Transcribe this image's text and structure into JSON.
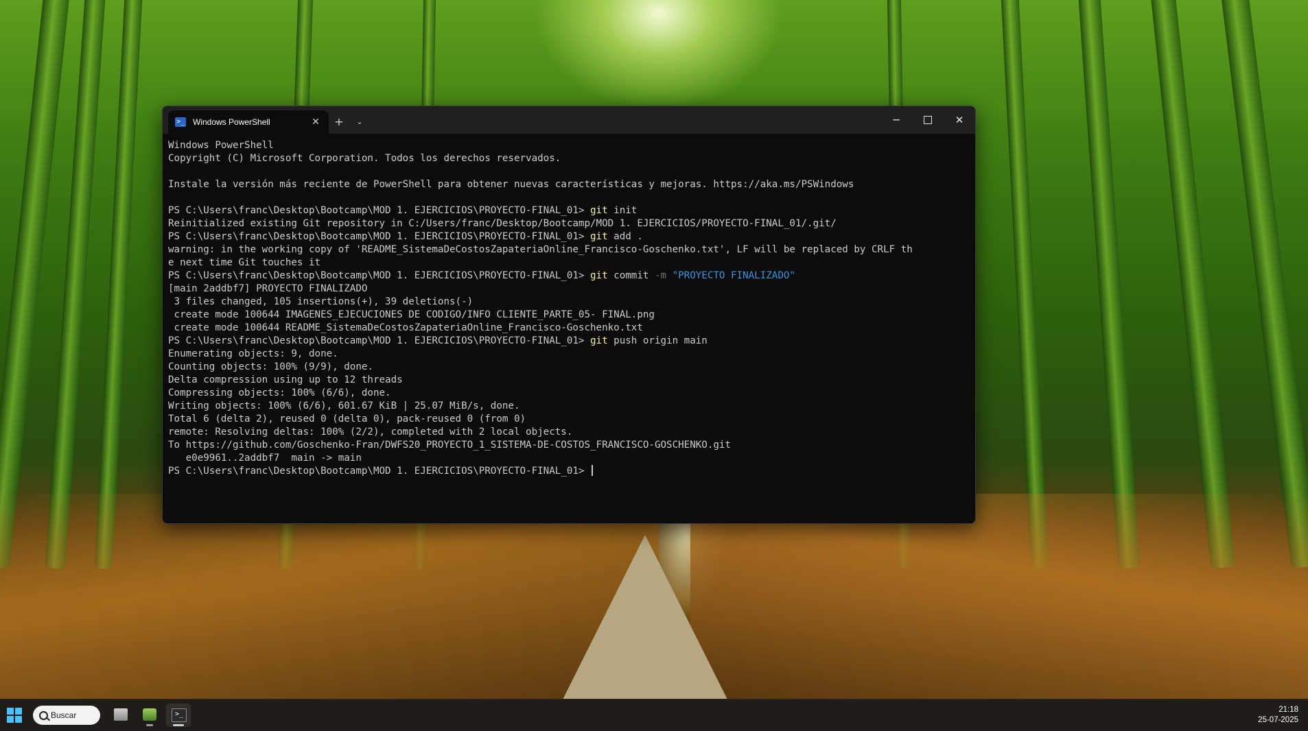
{
  "window": {
    "tab_title": "Windows PowerShell",
    "tab_icon": "powershell-icon",
    "new_tab_label": "+",
    "dropdown_icon": "chevron-down-icon",
    "minimize_icon": "minimize-icon",
    "maximize_icon": "maximize-icon",
    "close_icon": "close-icon"
  },
  "console": {
    "lines": [
      {
        "type": "text",
        "text": "Windows PowerShell"
      },
      {
        "type": "text",
        "text": "Copyright (C) Microsoft Corporation. Todos los derechos reservados."
      },
      {
        "type": "text",
        "text": ""
      },
      {
        "type": "text",
        "text": "Instale la versión más reciente de PowerShell para obtener nuevas características y mejoras. https://aka.ms/PSWindows"
      },
      {
        "type": "text",
        "text": ""
      },
      {
        "type": "cmd",
        "prompt": "PS C:\\Users\\franc\\Desktop\\Bootcamp\\MOD 1. EJERCICIOS\\PROYECTO-FINAL_01> ",
        "cmd": "git",
        "rest": " init"
      },
      {
        "type": "text",
        "text": "Reinitialized existing Git repository in C:/Users/franc/Desktop/Bootcamp/MOD 1. EJERCICIOS/PROYECTO-FINAL_01/.git/"
      },
      {
        "type": "cmd",
        "prompt": "PS C:\\Users\\franc\\Desktop\\Bootcamp\\MOD 1. EJERCICIOS\\PROYECTO-FINAL_01> ",
        "cmd": "git",
        "rest": " add ."
      },
      {
        "type": "text",
        "text": "warning: in the working copy of 'README_SistemaDeCostosZapateriaOnline_Francisco-Goschenko.txt', LF will be replaced by CRLF th"
      },
      {
        "type": "text",
        "text": "e next time Git touches it"
      },
      {
        "type": "cmd",
        "prompt": "PS C:\\Users\\franc\\Desktop\\Bootcamp\\MOD 1. EJERCICIOS\\PROYECTO-FINAL_01> ",
        "cmd": "git",
        "rest": " commit ",
        "flag": "-m",
        "str": " \"PROYECTO FINALIZADO\""
      },
      {
        "type": "text",
        "text": "[main 2addbf7] PROYECTO FINALIZADO"
      },
      {
        "type": "text",
        "text": " 3 files changed, 105 insertions(+), 39 deletions(-)"
      },
      {
        "type": "text",
        "text": " create mode 100644 IMAGENES_EJECUCIONES DE CODIGO/INFO CLIENTE_PARTE_05- FINAL.png"
      },
      {
        "type": "text",
        "text": " create mode 100644 README_SistemaDeCostosZapateriaOnline_Francisco-Goschenko.txt"
      },
      {
        "type": "cmd",
        "prompt": "PS C:\\Users\\franc\\Desktop\\Bootcamp\\MOD 1. EJERCICIOS\\PROYECTO-FINAL_01> ",
        "cmd": "git",
        "rest": " push origin main"
      },
      {
        "type": "text",
        "text": "Enumerating objects: 9, done."
      },
      {
        "type": "text",
        "text": "Counting objects: 100% (9/9), done."
      },
      {
        "type": "text",
        "text": "Delta compression using up to 12 threads"
      },
      {
        "type": "text",
        "text": "Compressing objects: 100% (6/6), done."
      },
      {
        "type": "text",
        "text": "Writing objects: 100% (6/6), 601.67 KiB | 25.07 MiB/s, done."
      },
      {
        "type": "text",
        "text": "Total 6 (delta 2), reused 0 (delta 0), pack-reused 0 (from 0)"
      },
      {
        "type": "text",
        "text": "remote: Resolving deltas: 100% (2/2), completed with 2 local objects."
      },
      {
        "type": "text",
        "text": "To https://github.com/Goschenko-Fran/DWFS20_PROYECTO_1_SISTEMA-DE-COSTOS_FRANCISCO-GOSCHENKO.git"
      },
      {
        "type": "text",
        "text": "   e0e9961..2addbf7  main -> main"
      },
      {
        "type": "prompt",
        "prompt": "PS C:\\Users\\franc\\Desktop\\Bootcamp\\MOD 1. EJERCICIOS\\PROYECTO-FINAL_01> "
      }
    ]
  },
  "taskbar": {
    "start_icon": "windows-start-icon",
    "search_label": "Buscar",
    "apps": [
      {
        "name": "file-explorer-icon",
        "active": false
      },
      {
        "name": "app-icon",
        "active": false
      },
      {
        "name": "terminal-icon",
        "active": true
      }
    ],
    "time": "21:18",
    "date": "25-07-2025"
  },
  "colors": {
    "console_bg": "#0c0c0c",
    "console_fg": "#cccccc",
    "cmd": "#f9f1a5",
    "string": "#3a96dd",
    "flag": "#767676",
    "start_accent": "#4cc2ff"
  }
}
